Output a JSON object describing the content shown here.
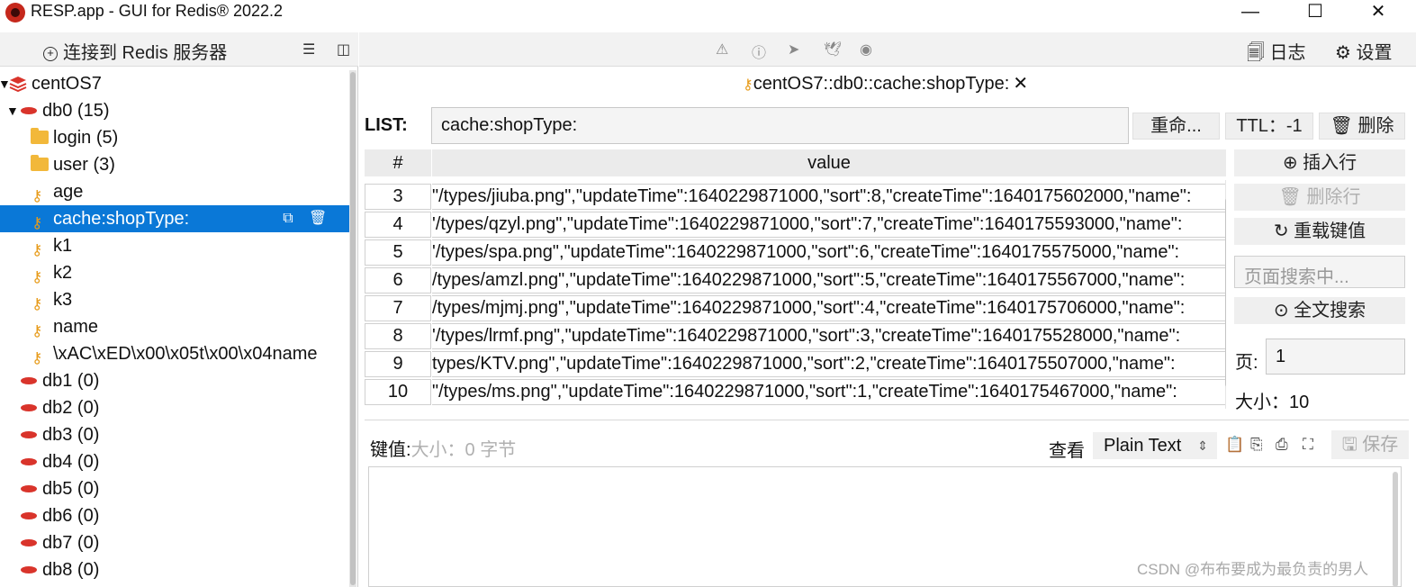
{
  "window": {
    "title": "RESP.app - GUI for Redis® 2022.2",
    "minimize": "—",
    "maximize": "☐",
    "close": "✕"
  },
  "sidebar": {
    "connect_label": "连接到 Redis 服务器",
    "connect_icon": "⊕",
    "list_icon": "☰",
    "layout_icon": "◫",
    "tree": {
      "server": "centOS7",
      "db0": "db0  (15)",
      "folders": [
        {
          "label": "login (5)"
        },
        {
          "label": "user (3)"
        }
      ],
      "keys": [
        {
          "label": "age"
        },
        {
          "label": "cache:shopType:"
        },
        {
          "label": "k1"
        },
        {
          "label": "k2"
        },
        {
          "label": "k3"
        },
        {
          "label": "name"
        },
        {
          "label": "\\xAC\\xED\\x00\\x05t\\x00\\x04name"
        }
      ],
      "selected_key": "cache:shopType:",
      "dbs": [
        {
          "label": "db1  (0)"
        },
        {
          "label": "db2  (0)"
        },
        {
          "label": "db3  (0)"
        },
        {
          "label": "db4  (0)"
        },
        {
          "label": "db5  (0)"
        },
        {
          "label": "db6  (0)"
        },
        {
          "label": "db7  (0)"
        },
        {
          "label": "db8  (0)"
        }
      ]
    }
  },
  "toolbar": {
    "log_label": "🗐 日志",
    "settings_label": "⚙ 设置"
  },
  "tab": {
    "label": "centOS7::db0::cache:shopType:",
    "close": "✕"
  },
  "key_view": {
    "type_label": "LIST:",
    "key_name": "cache:shopType:",
    "rename_label": "重命...",
    "ttl_label": "TTL：-1",
    "delete_label": "🗑 删除",
    "columns": [
      "#",
      "value"
    ],
    "rows": [
      {
        "num": "3",
        "value": "\"/types/jiuba.png\",\"updateTime\":1640229871000,\"sort\":8,\"createTime\":1640175602000,\"name\":"
      },
      {
        "num": "4",
        "value": "'/types/qzyl.png\",\"updateTime\":1640229871000,\"sort\":7,\"createTime\":1640175593000,\"name\":"
      },
      {
        "num": "5",
        "value": "'/types/spa.png\",\"updateTime\":1640229871000,\"sort\":6,\"createTime\":1640175575000,\"name\":"
      },
      {
        "num": "6",
        "value": "/types/amzl.png\",\"updateTime\":1640229871000,\"sort\":5,\"createTime\":1640175567000,\"name\":"
      },
      {
        "num": "7",
        "value": "/types/mjmj.png\",\"updateTime\":1640229871000,\"sort\":4,\"createTime\":1640175706000,\"name\":"
      },
      {
        "num": "8",
        "value": "'/types/lrmf.png\",\"updateTime\":1640229871000,\"sort\":3,\"createTime\":1640175528000,\"name\":"
      },
      {
        "num": "9",
        "value": "types/KTV.png\",\"updateTime\":1640229871000,\"sort\":2,\"createTime\":1640175507000,\"name\":"
      },
      {
        "num": "10",
        "value": "\"/types/ms.png\",\"updateTime\":1640229871000,\"sort\":1,\"createTime\":1640175467000,\"name\":"
      }
    ],
    "insert_row": "⊕ 插入行",
    "delete_row": "🗑 删除行",
    "reload": "↻ 重载键值",
    "page_search_placeholder": "页面搜索中...",
    "fulltext_search": "⊙ 全文搜索",
    "page_label": "页:",
    "page_value": "1",
    "size_label": "大小：10"
  },
  "value_editor": {
    "label": "键值:",
    "size_text": "大小：0 字节",
    "view_label": "查看",
    "format": "Plain Text",
    "save_label": "🖫 保存"
  },
  "watermark": "CSDN @布布要成为最负责的男人"
}
